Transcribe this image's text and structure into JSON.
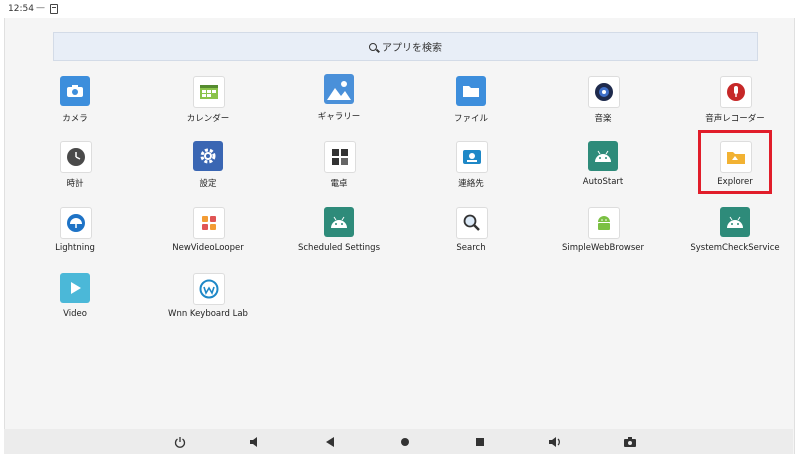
{
  "status": {
    "time": "12:54",
    "separator": "—"
  },
  "search": {
    "placeholder": "アプリを検索"
  },
  "apps": [
    {
      "label": "カメラ",
      "icon": "camera-icon"
    },
    {
      "label": "カレンダー",
      "icon": "calendar-icon"
    },
    {
      "label": "ギャラリー",
      "icon": "gallery-icon"
    },
    {
      "label": "ファイル",
      "icon": "folder-icon"
    },
    {
      "label": "音楽",
      "icon": "music-icon"
    },
    {
      "label": "音声レコーダー",
      "icon": "microphone-icon"
    },
    {
      "label": "時計",
      "icon": "clock-icon"
    },
    {
      "label": "設定",
      "icon": "gear-icon"
    },
    {
      "label": "電卓",
      "icon": "calculator-icon"
    },
    {
      "label": "連絡先",
      "icon": "contacts-icon"
    },
    {
      "label": "AutoStart",
      "icon": "android-icon"
    },
    {
      "label": "Explorer",
      "icon": "explorer-icon"
    },
    {
      "label": "Lightning",
      "icon": "umbrella-icon"
    },
    {
      "label": "NewVideoLooper",
      "icon": "video-looper-icon"
    },
    {
      "label": "Scheduled Settings",
      "icon": "android-icon"
    },
    {
      "label": "Search",
      "icon": "magnifier-icon"
    },
    {
      "label": "SimpleWebBrowser",
      "icon": "android-icon"
    },
    {
      "label": "SystemCheckService",
      "icon": "android-icon"
    },
    {
      "label": "Video",
      "icon": "play-icon"
    },
    {
      "label": "Wnn Keyboard Lab",
      "icon": "wnn-keyboard-icon"
    }
  ],
  "navigation": [
    "power-icon",
    "volume-down-icon",
    "back-icon",
    "home-icon",
    "recents-icon",
    "volume-up-icon",
    "screenshot-icon"
  ],
  "colors": {
    "highlight": "#e11d2a",
    "search_bg": "#e8eef7"
  }
}
